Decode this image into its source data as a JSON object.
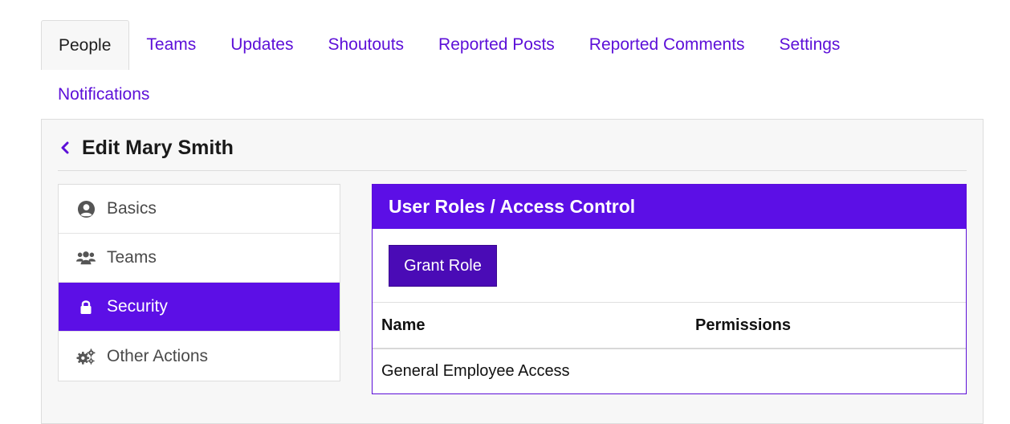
{
  "tabs": [
    {
      "label": "People",
      "active": true
    },
    {
      "label": "Teams"
    },
    {
      "label": "Updates"
    },
    {
      "label": "Shoutouts"
    },
    {
      "label": "Reported Posts"
    },
    {
      "label": "Reported Comments"
    },
    {
      "label": "Settings"
    },
    {
      "label": "Notifications"
    }
  ],
  "header": {
    "back_icon": "chevron-left-icon",
    "title": "Edit Mary Smith"
  },
  "sidebar": {
    "items": [
      {
        "label": "Basics",
        "icon": "user-circle-icon"
      },
      {
        "label": "Teams",
        "icon": "users-icon"
      },
      {
        "label": "Security",
        "icon": "lock-icon",
        "active": true
      },
      {
        "label": "Other Actions",
        "icon": "gears-icon"
      }
    ]
  },
  "roles": {
    "title": "User Roles / Access Control",
    "grant_label": "Grant Role",
    "columns": [
      "Name",
      "Permissions"
    ],
    "rows": [
      [
        "General Employee Access",
        ""
      ]
    ]
  },
  "colors": {
    "accent": "#5c0fe6",
    "button": "#4a0bb6"
  }
}
